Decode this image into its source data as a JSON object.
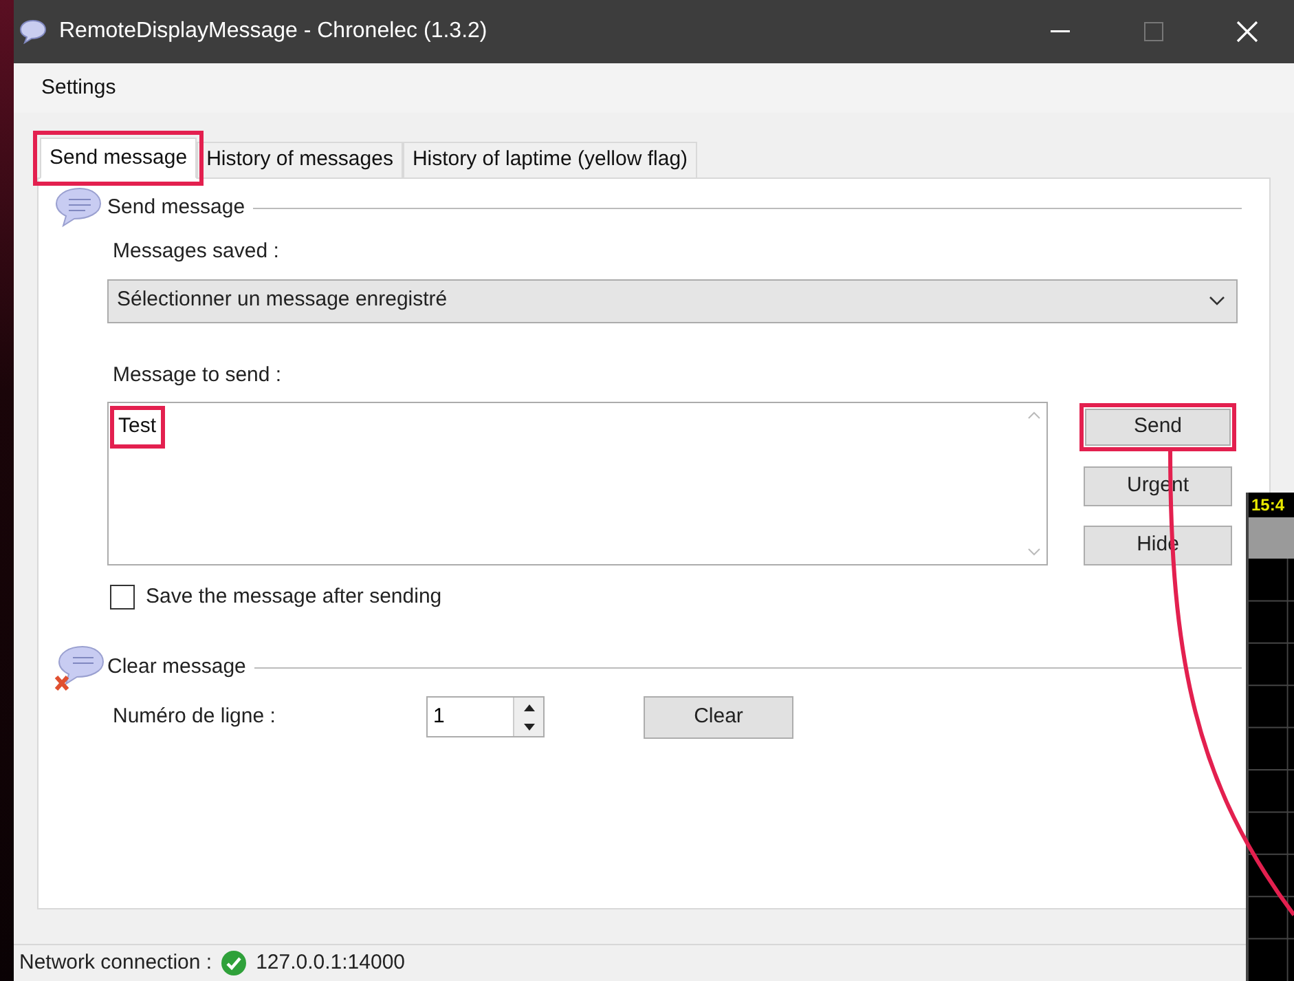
{
  "window": {
    "title": "RemoteDisplayMessage - Chronelec (1.3.2)"
  },
  "menu": [
    "Settings"
  ],
  "tabs": [
    {
      "label": "Send message",
      "selected": true,
      "highlighted": true
    },
    {
      "label": "History of messages",
      "selected": false,
      "highlighted": false
    },
    {
      "label": "History of laptime (yellow flag)",
      "selected": false,
      "highlighted": false
    }
  ],
  "send_group": {
    "title": "Send message",
    "saved_label": "Messages saved :",
    "saved_dropdown": {
      "value": "Sélectionner un message enregistré"
    },
    "message_label": "Message to send :",
    "message": {
      "value": "Test",
      "highlighted": true
    },
    "buttons": [
      {
        "label": "Send",
        "highlighted": true
      },
      {
        "label": "Urgent",
        "highlighted": false
      },
      {
        "label": "Hide",
        "highlighted": false
      }
    ],
    "save_checkbox": {
      "label": "Save the message after sending",
      "checked": false
    }
  },
  "clear_group": {
    "title": "Clear message",
    "line_label": "Numéro de ligne :",
    "line_number": "1",
    "button": "Clear"
  },
  "status_bar": {
    "label": "Network connection :",
    "connected": true,
    "address": "127.0.0.1:14000"
  },
  "background_window": {
    "time": "15:4"
  }
}
